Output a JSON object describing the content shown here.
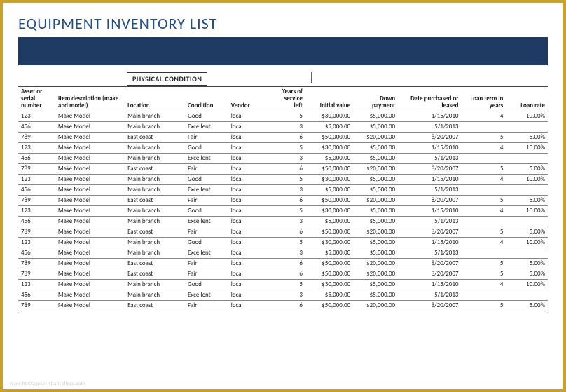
{
  "title": "EQUIPMENT INVENTORY LIST",
  "section_label": "PHYSICAL CONDITION",
  "watermark": "www.heritagechristiancollege.com",
  "columns": {
    "asset": "Asset or serial number",
    "desc": "Item description (make and model)",
    "loc": "Location",
    "cond": "Condition",
    "vendor": "Vendor",
    "years": "Years of service left",
    "initial": "Initial value",
    "down": "Down payment",
    "date": "Date purchased or leased",
    "term": "Loan term in years",
    "rate": "Loan rate"
  },
  "rows": [
    {
      "asset": "123",
      "desc": "Make Model",
      "loc": "Main branch",
      "cond": "Good",
      "vendor": "local",
      "years": "5",
      "initial": "$30,000.00",
      "down": "$5,000.00",
      "date": "1/15/2010",
      "term": "4",
      "rate": "10.00%"
    },
    {
      "asset": "456",
      "desc": "Make Model",
      "loc": "Main branch",
      "cond": "Excellent",
      "vendor": "local",
      "years": "3",
      "initial": "$5,000.00",
      "down": "$5,000.00",
      "date": "5/1/2013",
      "term": "",
      "rate": ""
    },
    {
      "asset": "789",
      "desc": "Make Model",
      "loc": "East coast",
      "cond": "Fair",
      "vendor": "local",
      "years": "6",
      "initial": "$50,000.00",
      "down": "$20,000.00",
      "date": "8/20/2007",
      "term": "5",
      "rate": "5.00%"
    },
    {
      "asset": "123",
      "desc": "Make Model",
      "loc": "Main branch",
      "cond": "Good",
      "vendor": "local",
      "years": "5",
      "initial": "$30,000.00",
      "down": "$5,000.00",
      "date": "1/15/2010",
      "term": "4",
      "rate": "10.00%"
    },
    {
      "asset": "456",
      "desc": "Make Model",
      "loc": "Main branch",
      "cond": "Excellent",
      "vendor": "local",
      "years": "3",
      "initial": "$5,000.00",
      "down": "$5,000.00",
      "date": "5/1/2013",
      "term": "",
      "rate": ""
    },
    {
      "asset": "789",
      "desc": "Make Model",
      "loc": "East coast",
      "cond": "Fair",
      "vendor": "local",
      "years": "6",
      "initial": "$50,000.00",
      "down": "$20,000.00",
      "date": "8/20/2007",
      "term": "5",
      "rate": "5.00%"
    },
    {
      "asset": "123",
      "desc": "Make Model",
      "loc": "Main branch",
      "cond": "Good",
      "vendor": "local",
      "years": "5",
      "initial": "$30,000.00",
      "down": "$5,000.00",
      "date": "1/15/2010",
      "term": "4",
      "rate": "10.00%"
    },
    {
      "asset": "456",
      "desc": "Make Model",
      "loc": "Main branch",
      "cond": "Excellent",
      "vendor": "local",
      "years": "3",
      "initial": "$5,000.00",
      "down": "$5,000.00",
      "date": "5/1/2013",
      "term": "",
      "rate": ""
    },
    {
      "asset": "789",
      "desc": "Make Model",
      "loc": "East coast",
      "cond": "Fair",
      "vendor": "local",
      "years": "6",
      "initial": "$50,000.00",
      "down": "$20,000.00",
      "date": "8/20/2007",
      "term": "5",
      "rate": "5.00%"
    },
    {
      "asset": "123",
      "desc": "Make Model",
      "loc": "Main branch",
      "cond": "Good",
      "vendor": "local",
      "years": "5",
      "initial": "$30,000.00",
      "down": "$5,000.00",
      "date": "1/15/2010",
      "term": "4",
      "rate": "10.00%"
    },
    {
      "asset": "456",
      "desc": "Make Model",
      "loc": "Main branch",
      "cond": "Excellent",
      "vendor": "local",
      "years": "3",
      "initial": "$5,000.00",
      "down": "$5,000.00",
      "date": "5/1/2013",
      "term": "",
      "rate": ""
    },
    {
      "asset": "789",
      "desc": "Make Model",
      "loc": "East coast",
      "cond": "Fair",
      "vendor": "local",
      "years": "6",
      "initial": "$50,000.00",
      "down": "$20,000.00",
      "date": "8/20/2007",
      "term": "5",
      "rate": "5.00%"
    },
    {
      "asset": "123",
      "desc": "Make Model",
      "loc": "Main branch",
      "cond": "Good",
      "vendor": "local",
      "years": "5",
      "initial": "$30,000.00",
      "down": "$5,000.00",
      "date": "1/15/2010",
      "term": "4",
      "rate": "10.00%"
    },
    {
      "asset": "456",
      "desc": "Make Model",
      "loc": "Main branch",
      "cond": "Excellent",
      "vendor": "local",
      "years": "3",
      "initial": "$5,000.00",
      "down": "$5,000.00",
      "date": "5/1/2013",
      "term": "",
      "rate": ""
    },
    {
      "asset": "789",
      "desc": "Make Model",
      "loc": "East coast",
      "cond": "Fair",
      "vendor": "local",
      "years": "6",
      "initial": "$50,000.00",
      "down": "$20,000.00",
      "date": "8/20/2007",
      "term": "5",
      "rate": "5.00%"
    },
    {
      "asset": "789",
      "desc": "Make Model",
      "loc": "East coast",
      "cond": "Fair",
      "vendor": "local",
      "years": "6",
      "initial": "$50,000.00",
      "down": "$20,000.00",
      "date": "8/20/2007",
      "term": "5",
      "rate": "5.00%"
    },
    {
      "asset": "123",
      "desc": "Make Model",
      "loc": "Main branch",
      "cond": "Good",
      "vendor": "local",
      "years": "5",
      "initial": "$30,000.00",
      "down": "$5,000.00",
      "date": "1/15/2010",
      "term": "4",
      "rate": "10.00%"
    },
    {
      "asset": "456",
      "desc": "Make Model",
      "loc": "Main branch",
      "cond": "Excellent",
      "vendor": "local",
      "years": "3",
      "initial": "$5,000.00",
      "down": "$5,000.00",
      "date": "5/1/2013",
      "term": "",
      "rate": ""
    },
    {
      "asset": "789",
      "desc": "Make Model",
      "loc": "East coast",
      "cond": "Fair",
      "vendor": "local",
      "years": "6",
      "initial": "$50,000.00",
      "down": "$20,000.00",
      "date": "8/20/2007",
      "term": "5",
      "rate": "5.00%"
    }
  ]
}
